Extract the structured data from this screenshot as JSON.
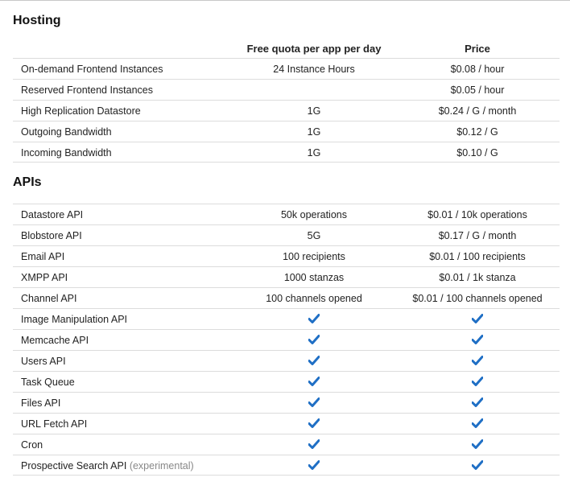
{
  "hosting": {
    "title": "Hosting",
    "columns": {
      "quota": "Free quota per app per day",
      "price": "Price"
    },
    "rows": [
      {
        "name": "On-demand Frontend Instances",
        "quota": "24 Instance Hours",
        "price": "$0.08 / hour"
      },
      {
        "name": "Reserved Frontend Instances",
        "quota": "",
        "price": "$0.05 / hour"
      },
      {
        "name": "High Replication Datastore",
        "quota": "1G",
        "price": "$0.24 / G / month"
      },
      {
        "name": "Outgoing Bandwidth",
        "quota": "1G",
        "price": "$0.12 / G"
      },
      {
        "name": "Incoming Bandwidth",
        "quota": "1G",
        "price": "$0.10 / G"
      }
    ]
  },
  "apis": {
    "title": "APIs",
    "rows": [
      {
        "name": "Datastore API",
        "quota": "50k operations",
        "price": "$0.01 / 10k operations"
      },
      {
        "name": "Blobstore API",
        "quota": "5G",
        "price": "$0.17 / G / month"
      },
      {
        "name": "Email API",
        "quota": "100 recipients",
        "price": "$0.01 / 100 recipients"
      },
      {
        "name": "XMPP API",
        "quota": "1000 stanzas",
        "price": "$0.01 / 1k stanza"
      },
      {
        "name": "Channel API",
        "quota": "100 channels opened",
        "price": "$0.01 / 100 channels opened"
      },
      {
        "name": "Image Manipulation API",
        "quota_icon": "checkmark-icon",
        "price_icon": "checkmark-icon"
      },
      {
        "name": "Memcache API",
        "quota_icon": "checkmark-icon",
        "price_icon": "checkmark-icon"
      },
      {
        "name": "Users API",
        "quota_icon": "checkmark-icon",
        "price_icon": "checkmark-icon"
      },
      {
        "name": "Task Queue",
        "quota_icon": "checkmark-icon",
        "price_icon": "checkmark-icon"
      },
      {
        "name": "Files API",
        "quota_icon": "checkmark-icon",
        "price_icon": "checkmark-icon"
      },
      {
        "name": "URL Fetch API",
        "quota_icon": "checkmark-icon",
        "price_icon": "checkmark-icon"
      },
      {
        "name": "Cron",
        "quota_icon": "checkmark-icon",
        "price_icon": "checkmark-icon"
      },
      {
        "name": "Prospective Search API",
        "note": "(experimental)",
        "quota_icon": "checkmark-icon",
        "price_icon": "checkmark-icon"
      }
    ]
  },
  "colors": {
    "check": "#1f6fc5",
    "rule": "#dcdcdc",
    "note": "#888888"
  }
}
